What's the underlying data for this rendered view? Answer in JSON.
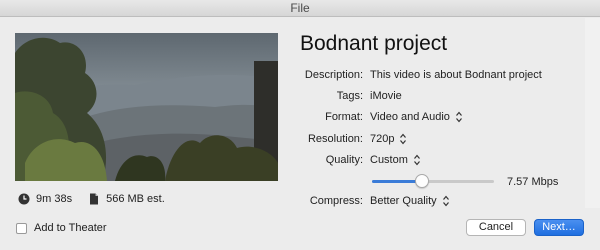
{
  "window": {
    "title": "File"
  },
  "project": {
    "title": "Bodnant project"
  },
  "fields": {
    "description": {
      "label": "Description:",
      "value": "This video is about Bodnant project"
    },
    "tags": {
      "label": "Tags:",
      "value": "iMovie"
    },
    "format": {
      "label": "Format:",
      "value": "Video and Audio"
    },
    "resolution": {
      "label": "Resolution:",
      "value": "720p"
    },
    "quality": {
      "label": "Quality:",
      "value": "Custom"
    },
    "bitrate": {
      "value": "7.57 Mbps",
      "level": 0.41
    },
    "compress": {
      "label": "Compress:",
      "value": "Better Quality"
    }
  },
  "meta": {
    "duration": "9m 38s",
    "size": "566 MB est."
  },
  "footer": {
    "add_to_theater": "Add to Theater",
    "cancel_label": "Cancel",
    "next_label": "Next…"
  },
  "icons": {
    "clock": "clock-icon",
    "file": "file-icon",
    "stepper": "up-down-chevron-icon"
  },
  "colors": {
    "accent": "#1f6fe0",
    "slider_fill": "#3b7cd8"
  }
}
